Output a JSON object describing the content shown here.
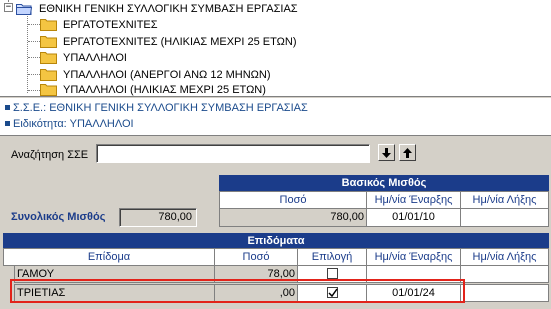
{
  "tree": {
    "root": "ΕΘΝΙΚΗ ΓΕΝΙΚΗ ΣΥΛΛΟΓΙΚΗ ΣΥΜΒΑΣΗ ΕΡΓΑΣΙΑΣ",
    "items": [
      "ΕΡΓΑΤΟΤΕΧΝΙΤΕΣ",
      "ΕΡΓΑΤΟΤΕΧΝΙΤΕΣ (ΗΛΙΚΙΑΣ ΜΕΧΡΙ 25 ΕΤΩΝ)",
      "ΥΠΑΛΛΗΛΟΙ",
      "ΥΠΑΛΛΗΛΟΙ (ΑΝΕΡΓΟΙ ΑΝΩ 12 ΜΗΝΩΝ)",
      "ΥΠΑΛΛΗΛΟΙ (ΗΛΙΚΙΑΣ ΜΕΧΡΙ 25 ΕΤΩΝ)"
    ],
    "expander": "−"
  },
  "info": {
    "sse": "Σ.Σ.Ε.: ΕΘΝΙΚΗ ΓΕΝΙΚΗ ΣΥΛΛΟΓΙΚΗ ΣΥΜΒΑΣΗ ΕΡΓΑΣΙΑΣ",
    "specialty": "Ειδικότητα: ΥΠΑΛΛΗΛΟΙ"
  },
  "search": {
    "label": "Αναζήτηση ΣΣΕ",
    "value": "",
    "down_icon": "arrow-down-icon",
    "up_icon": "arrow-up-icon"
  },
  "basic_salary": {
    "title": "Βασικός Μισθός",
    "col_amount": "Ποσό",
    "col_start": "Ημ/νία Έναρξης",
    "col_end": "Ημ/νία Λήξης",
    "amount": "780,00",
    "start": "01/01/10",
    "end": ""
  },
  "total": {
    "label": "Συνολικός Μισθός",
    "value": "780,00"
  },
  "allowances": {
    "title": "Επιδόματα",
    "columns": [
      "Επίδομα",
      "Ποσό",
      "Επιλογή",
      "Ημ/νία Έναρξης",
      "Ημ/νία Λήξης"
    ],
    "rows": [
      {
        "name": "ΓΑΜΟΥ",
        "amount": "78,00",
        "checked": false,
        "start": "",
        "end": ""
      },
      {
        "name": "ΤΡΙΕΤΙΑΣ",
        "amount": ",00",
        "checked": true,
        "start": "01/01/24",
        "end": ""
      }
    ]
  },
  "colors": {
    "accent": "#1b3c8a",
    "highlight": "#e2231a",
    "folder": "#f4c542"
  }
}
